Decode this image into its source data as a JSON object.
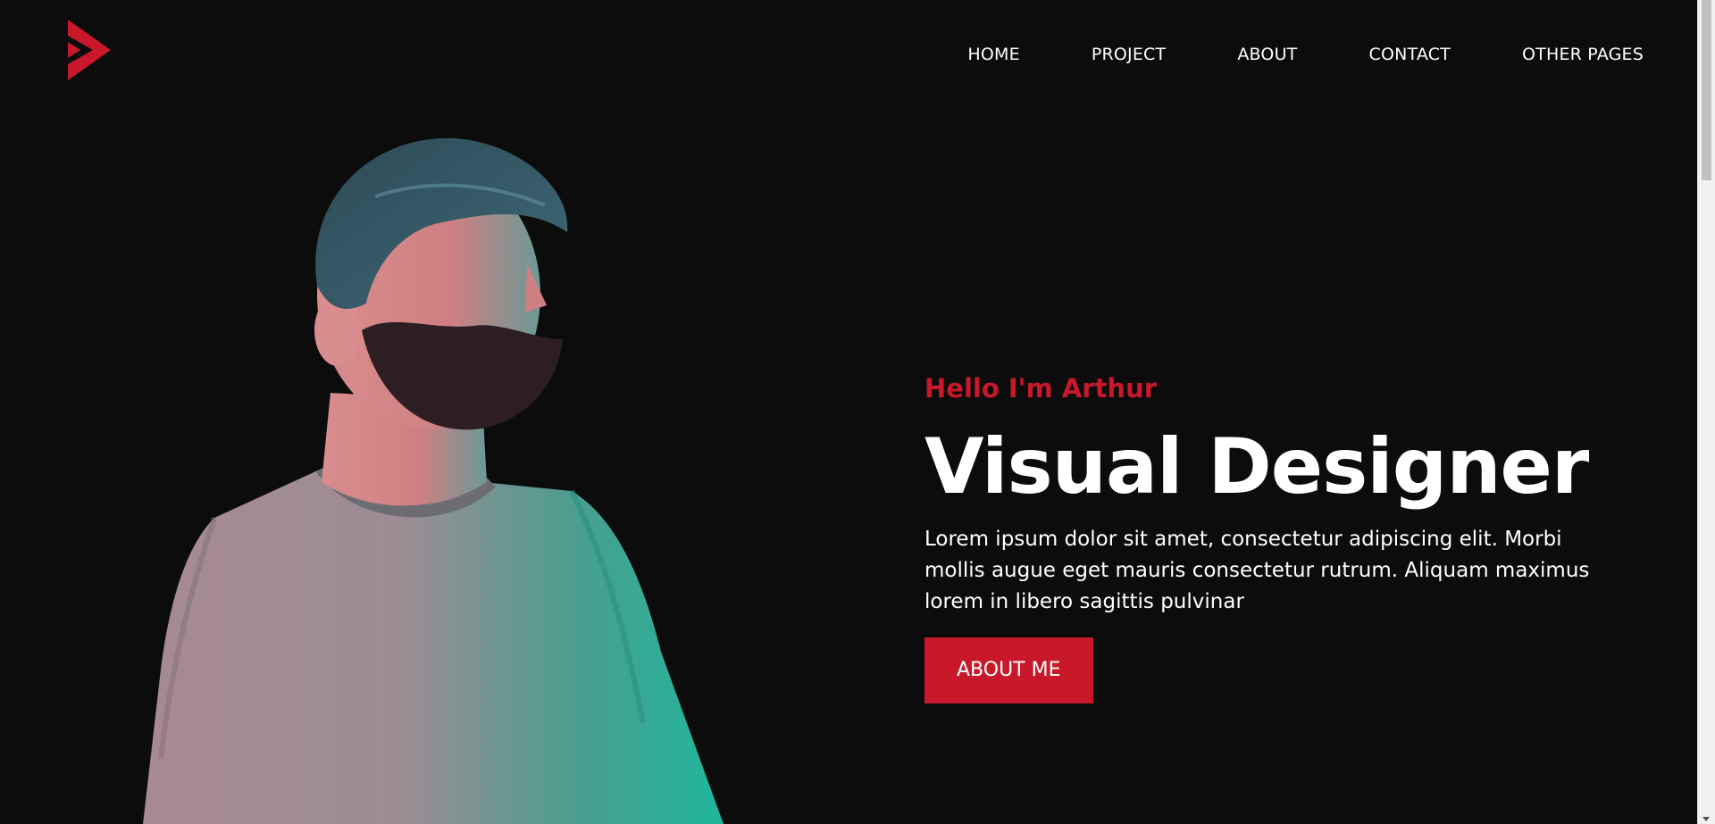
{
  "brand": {
    "logo_icon": "play-chevron-logo-icon",
    "accent_color": "#c8182a"
  },
  "nav": {
    "items": [
      {
        "label": "HOME"
      },
      {
        "label": "PROJECT"
      },
      {
        "label": "ABOUT"
      },
      {
        "label": "CONTACT"
      },
      {
        "label": "OTHER PAGES"
      }
    ]
  },
  "hero": {
    "greeting": "Hello I'm Arthur",
    "headline": "Visual Designer",
    "intro": "Lorem ipsum dolor sit amet, consectetur adipiscing elit. Morbi mollis augue eget mauris consectetur rutrum. Aliquam maximus lorem in libero sagittis pulvinar",
    "cta_label": "ABOUT ME",
    "portrait_icon": "portrait-image"
  },
  "colors": {
    "background": "#0c0c0d",
    "text": "#ffffff",
    "accent": "#c8182a"
  }
}
